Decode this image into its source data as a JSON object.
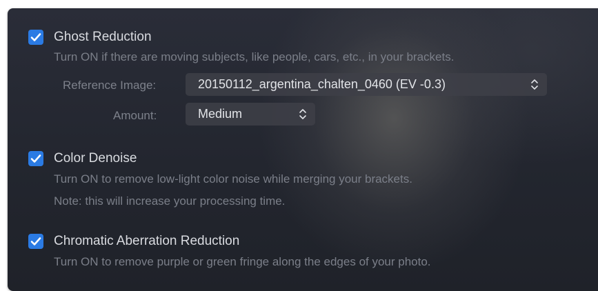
{
  "ghost_reduction": {
    "checked": true,
    "title": "Ghost Reduction",
    "description": "Turn ON if there are moving subjects, like people, cars, etc., in your brackets.",
    "reference_image": {
      "label": "Reference Image:",
      "value": "20150112_argentina_chalten_0460 (EV -0.3)"
    },
    "amount": {
      "label": "Amount:",
      "value": "Medium"
    }
  },
  "color_denoise": {
    "checked": true,
    "title": "Color Denoise",
    "description": "Turn ON to remove low-light color noise while merging your brackets.",
    "note": "Note: this will increase your processing time."
  },
  "chromatic_aberration": {
    "checked": true,
    "title": "Chromatic Aberration Reduction",
    "description": "Turn ON to remove purple or green fringe along the edges of your photo."
  },
  "colors": {
    "accent": "#2b7be4",
    "panel_bg": "#23262f",
    "title_text": "#d9dbe0",
    "secondary_text": "#7b7f89"
  }
}
